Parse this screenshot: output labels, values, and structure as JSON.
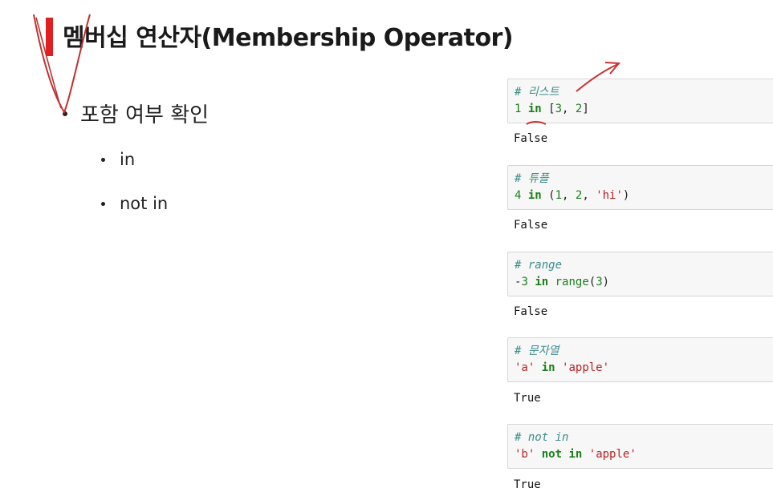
{
  "slide": {
    "title": "멤버십 연산자(Membership Operator)",
    "bullet_main": "포함 여부 확인",
    "sub_bullets": [
      "in",
      "not in"
    ]
  },
  "cells": [
    {
      "comment": "# 리스트",
      "code": [
        {
          "t": "1",
          "c": "num"
        },
        {
          "t": " ",
          "c": ""
        },
        {
          "t": "in",
          "c": "kw"
        },
        {
          "t": " [",
          "c": ""
        },
        {
          "t": "3",
          "c": "num"
        },
        {
          "t": ", ",
          "c": ""
        },
        {
          "t": "2",
          "c": "num"
        },
        {
          "t": "]",
          "c": ""
        }
      ],
      "output": "False"
    },
    {
      "comment": "# 튜플",
      "code": [
        {
          "t": "4",
          "c": "num"
        },
        {
          "t": " ",
          "c": ""
        },
        {
          "t": "in",
          "c": "kw"
        },
        {
          "t": " (",
          "c": ""
        },
        {
          "t": "1",
          "c": "num"
        },
        {
          "t": ", ",
          "c": ""
        },
        {
          "t": "2",
          "c": "num"
        },
        {
          "t": ", ",
          "c": ""
        },
        {
          "t": "'hi'",
          "c": "str"
        },
        {
          "t": ")",
          "c": ""
        }
      ],
      "output": "False"
    },
    {
      "comment": "# range",
      "code": [
        {
          "t": "-",
          "c": ""
        },
        {
          "t": "3",
          "c": "num"
        },
        {
          "t": " ",
          "c": ""
        },
        {
          "t": "in",
          "c": "kw"
        },
        {
          "t": " ",
          "c": ""
        },
        {
          "t": "range",
          "c": "fn"
        },
        {
          "t": "(",
          "c": ""
        },
        {
          "t": "3",
          "c": "num"
        },
        {
          "t": ")",
          "c": ""
        }
      ],
      "output": "False"
    },
    {
      "comment": "# 문자열",
      "code": [
        {
          "t": "'a'",
          "c": "str"
        },
        {
          "t": " ",
          "c": ""
        },
        {
          "t": "in",
          "c": "kw"
        },
        {
          "t": " ",
          "c": ""
        },
        {
          "t": "'apple'",
          "c": "str"
        }
      ],
      "output": "True"
    },
    {
      "comment": "# not in",
      "code": [
        {
          "t": "'b'",
          "c": "str"
        },
        {
          "t": " ",
          "c": ""
        },
        {
          "t": "not",
          "c": "kw"
        },
        {
          "t": " ",
          "c": ""
        },
        {
          "t": "in",
          "c": "kw"
        },
        {
          "t": " ",
          "c": ""
        },
        {
          "t": "'apple'",
          "c": "str"
        }
      ],
      "output": "True"
    }
  ],
  "colors": {
    "accent": "#e02020",
    "comment": "#3d8c8c",
    "keyword": "#1a7f1a",
    "string": "#ba2121"
  }
}
